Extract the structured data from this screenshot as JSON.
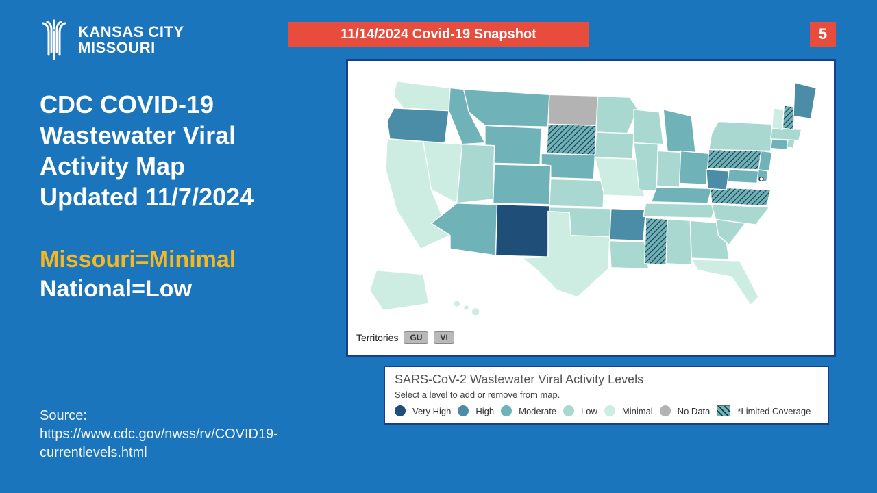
{
  "header": {
    "org_line1": "KANSAS CITY",
    "org_line2": "MISSOURI",
    "banner": "11/14/2024 Covid-19 Snapshot",
    "page": "5"
  },
  "title": {
    "l1": "CDC COVID-19",
    "l2": "Wastewater Viral",
    "l3": "Activity Map",
    "l4": "Updated 11/7/2024"
  },
  "status": {
    "mo": "Missouri=Minimal",
    "nat": "National=Low"
  },
  "source": {
    "prefix": "Source: ",
    "url_l1": "https://www.cdc.gov/nwss/rv/COVID19-",
    "url_l2": "currentlevels.html"
  },
  "map": {
    "territories_label": "Territories",
    "territories": [
      "GU",
      "VI"
    ]
  },
  "legend": {
    "title": "SARS-CoV-2 Wastewater Viral Activity Levels",
    "subtitle": "Select a level to add or remove from map.",
    "levels": [
      {
        "label": "Very High",
        "color": "#1F4E79"
      },
      {
        "label": "High",
        "color": "#4B8CA6"
      },
      {
        "label": "Moderate",
        "color": "#6FB3B8"
      },
      {
        "label": "Low",
        "color": "#A8D8CF"
      },
      {
        "label": "Minimal",
        "color": "#CDEDE3"
      },
      {
        "label": "No Data",
        "color": "#B3B3B3"
      },
      {
        "label": "*Limited Coverage",
        "pattern": "hatch"
      }
    ]
  },
  "chart_data": {
    "type": "choropleth-map",
    "title": "SARS-CoV-2 Wastewater Viral Activity Levels",
    "region": "United States",
    "update_date": "11/7/2024",
    "scale": [
      "Minimal",
      "Low",
      "Moderate",
      "High",
      "Very High",
      "No Data",
      "Limited Coverage"
    ],
    "national_level": "Low",
    "states": {
      "AL": "Low",
      "AK": "Minimal",
      "AZ": "Moderate",
      "AR": "High",
      "CA": "Minimal",
      "CO": "Moderate",
      "CT": "Moderate",
      "DE": "Moderate",
      "FL": "Minimal",
      "GA": "Low",
      "HI": "Minimal",
      "ID": "Moderate",
      "IL": "Low",
      "IN": "Low",
      "IA": "Low",
      "KS": "Low",
      "KY": "Moderate",
      "LA": "Low",
      "ME": "High",
      "MD": "Moderate",
      "MA": "Low",
      "MI": "Moderate",
      "MN": "Low",
      "MS": "Limited Coverage",
      "MO": "Minimal",
      "MT": "Moderate",
      "NE": "Moderate",
      "NV": "Minimal",
      "NH": "Limited Coverage",
      "NJ": "Moderate",
      "NM": "Very High",
      "NY": "Low",
      "NC": "Low",
      "ND": "No Data",
      "OH": "Moderate",
      "OK": "Low",
      "OR": "High",
      "PA": "Limited Coverage",
      "RI": "Low",
      "SC": "Low",
      "SD": "Limited Coverage",
      "TN": "Low",
      "TX": "Minimal",
      "UT": "Low",
      "VT": "Minimal",
      "VA": "Limited Coverage",
      "WA": "Minimal",
      "WV": "High",
      "WI": "Low",
      "WY": "Moderate",
      "GU": "No Data",
      "VI": "No Data"
    }
  }
}
